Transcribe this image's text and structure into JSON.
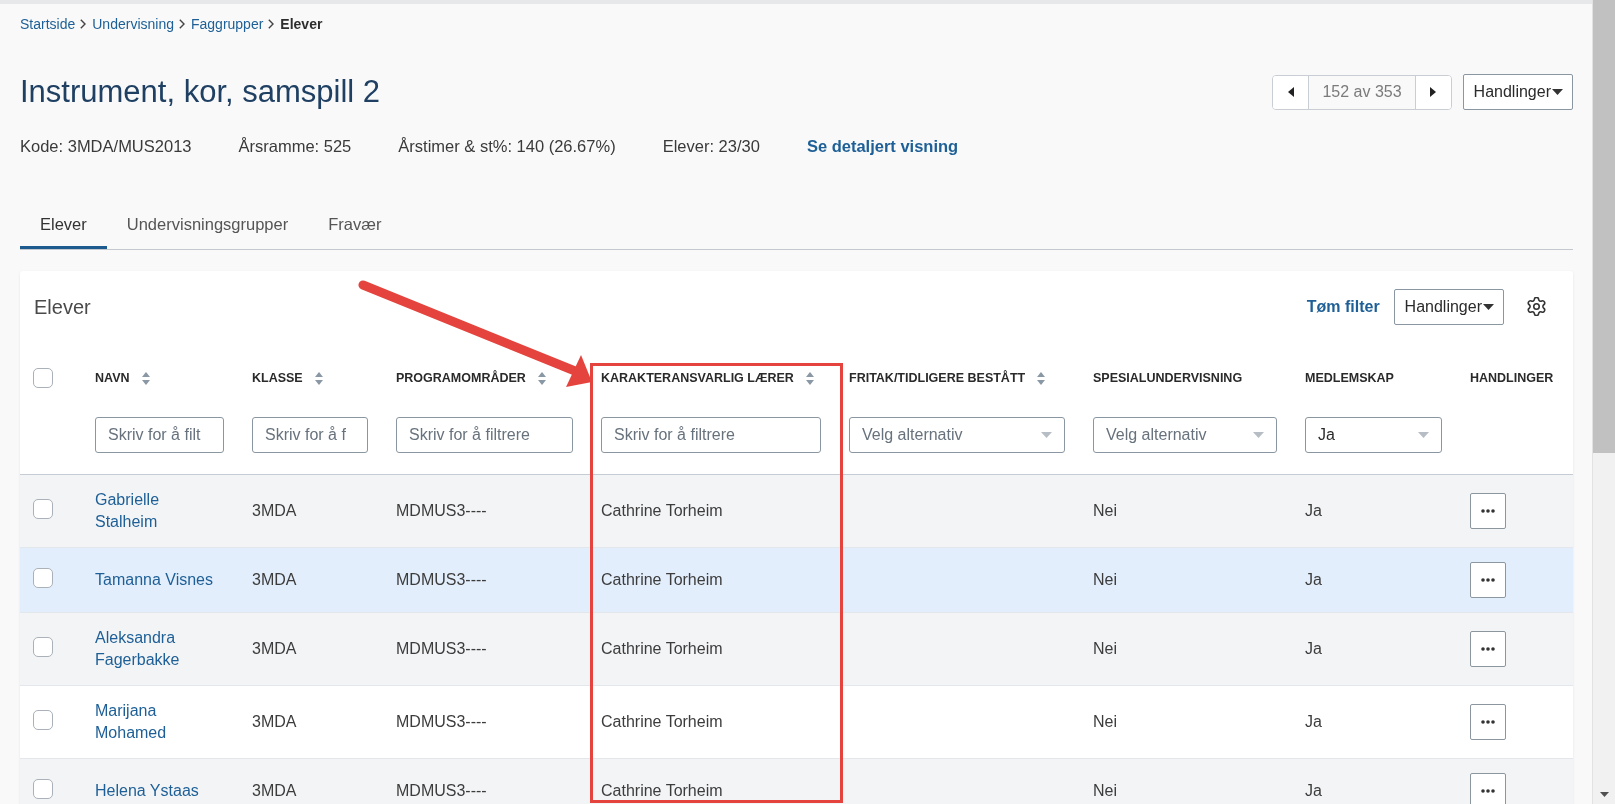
{
  "breadcrumb": [
    {
      "label": "Startside",
      "current": false
    },
    {
      "label": "Undervisning",
      "current": false
    },
    {
      "label": "Faggrupper",
      "current": false
    },
    {
      "label": "Elever",
      "current": true
    }
  ],
  "header": {
    "title": "Instrument, kor, samspill 2",
    "pager": {
      "label": "152 av 353"
    },
    "actions": "Handlinger"
  },
  "meta": [
    {
      "kind": "text",
      "label": "Kode: 3MDA/MUS2013"
    },
    {
      "kind": "text",
      "label": "Årsramme: 525"
    },
    {
      "kind": "text",
      "label": "Årstimer & st%: 140 (26.67%)"
    },
    {
      "kind": "text",
      "label": "Elever: 23/30"
    },
    {
      "kind": "link",
      "label": "Se detaljert visning"
    }
  ],
  "tabs": [
    {
      "label": "Elever",
      "selected": true
    },
    {
      "label": "Undervisningsgrupper",
      "selected": false
    },
    {
      "label": "Fravær",
      "selected": false
    }
  ],
  "card": {
    "title": "Elever",
    "clear_filter": "Tøm filter",
    "actions": "Handlinger"
  },
  "table": {
    "select_all": {
      "checked": false
    },
    "columns": [
      {
        "label": "NAVN",
        "sortable": true,
        "filter": {
          "kind": "text",
          "placeholder": "Skriv for å filt"
        }
      },
      {
        "label": "KLASSE",
        "sortable": true,
        "filter": {
          "kind": "text",
          "placeholder": "Skriv for å f"
        }
      },
      {
        "label": "PROGRAMOMRÅDER",
        "sortable": true,
        "filter": {
          "kind": "text",
          "placeholder": "Skriv for å filtrere"
        }
      },
      {
        "label": "KARAKTERANSVARLIG LÆRER",
        "sortable": true,
        "filter": {
          "kind": "text",
          "placeholder": "Skriv for å filtrere"
        }
      },
      {
        "label": "FRITAK/TIDLIGERE BESTÅTT",
        "sortable": true,
        "filter": {
          "kind": "select",
          "placeholder": "Velg alternativ"
        }
      },
      {
        "label": "SPESIALUNDERVISNING",
        "sortable": false,
        "filter": {
          "kind": "select",
          "placeholder": "Velg alternativ"
        }
      },
      {
        "label": "MEDLEMSKAP",
        "sortable": false,
        "filter": {
          "kind": "select",
          "value": "Ja"
        }
      },
      {
        "label": "HANDLINGER",
        "sortable": false
      }
    ],
    "rows": [
      {
        "checked": false,
        "highlighted": false,
        "name": "Gabrielle Stalheim",
        "class": "3MDA",
        "program_area": "MDMUS3----",
        "grade_teacher": "Cathrine Torheim",
        "special_education": "Nei",
        "membership": "Ja"
      },
      {
        "checked": false,
        "highlighted": true,
        "name": "Tamanna Visnes",
        "class": "3MDA",
        "program_area": "MDMUS3----",
        "grade_teacher": "Cathrine Torheim",
        "special_education": "Nei",
        "membership": "Ja"
      },
      {
        "checked": false,
        "highlighted": false,
        "name": "Aleksandra Fagerbakke",
        "class": "3MDA",
        "program_area": "MDMUS3----",
        "grade_teacher": "Cathrine Torheim",
        "special_education": "Nei",
        "membership": "Ja"
      },
      {
        "checked": false,
        "highlighted": false,
        "name": "Marijana Mohamed",
        "class": "3MDA",
        "program_area": "MDMUS3----",
        "grade_teacher": "Cathrine Torheim",
        "special_education": "Nei",
        "membership": "Ja"
      },
      {
        "checked": false,
        "highlighted": false,
        "name": "Helena Ystaas",
        "class": "3MDA",
        "program_area": "MDMUS3----",
        "grade_teacher": "Cathrine Torheim",
        "special_education": "Nei",
        "membership": "Ja"
      }
    ]
  }
}
